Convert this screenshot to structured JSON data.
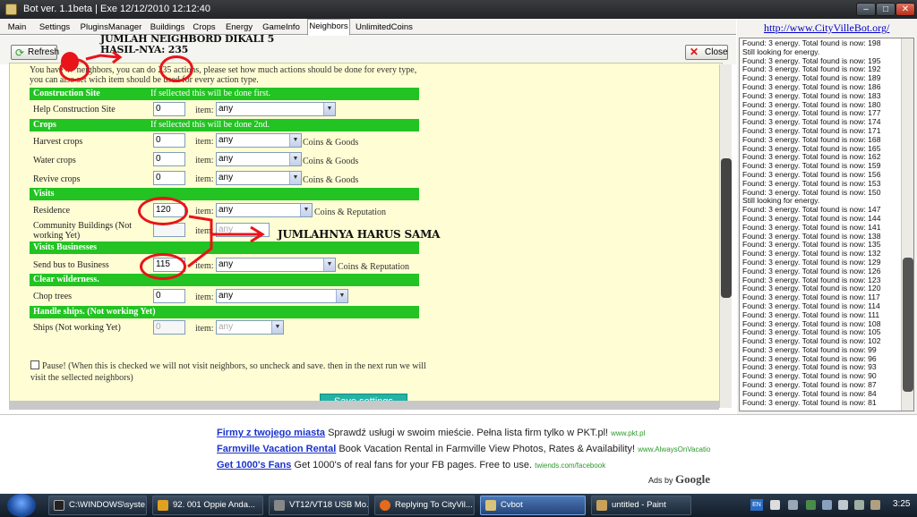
{
  "window": {
    "title": "Bot ver. 1.1beta | Exe 12/12/2010 12:12:40"
  },
  "tabs": [
    "Main",
    "Settings",
    "PluginsManager",
    "Buildings",
    "Crops",
    "Energy",
    "GameInfo",
    "Neighbors",
    "UnlimitedCoins"
  ],
  "active_tab": "Neighbors",
  "toolbar": {
    "refresh": "Refresh",
    "close": "Close"
  },
  "info_text": "You have 47 neighbors, you can do 235 actions, please set how much actions should be done for every type, you can also set wich item should be used for every action type.",
  "form": {
    "item_label": "item:",
    "construction": {
      "title": "Construction Site",
      "note": "If sellected this will be done first.",
      "row_label": "Help Construction Site",
      "value": "0",
      "item": "any"
    },
    "crops": {
      "title": "Crops",
      "note": "If sellected this will be done 2nd.",
      "harvest": {
        "label": "Harvest crops",
        "value": "0",
        "item": "any",
        "suffix": "Coins & Goods"
      },
      "water": {
        "label": "Water crops",
        "value": "0",
        "item": "any",
        "suffix": "Coins & Goods"
      },
      "revive": {
        "label": "Revive crops",
        "value": "0",
        "item": "any",
        "suffix": "Coins & Goods"
      }
    },
    "visits": {
      "title": "Visits",
      "residence": {
        "label": "Residence",
        "value": "120",
        "item": "any",
        "suffix": "Coins & Reputation"
      },
      "community": {
        "label": "Community Buildings (Not working Yet)",
        "value": "",
        "item": "any"
      }
    },
    "businesses": {
      "title": "Visits Businesses",
      "bus": {
        "label": "Send bus to Business",
        "value": "115",
        "item": "any",
        "suffix": "Coins & Reputation"
      }
    },
    "wilderness": {
      "title": "Clear wilderness.",
      "chop": {
        "label": "Chop trees",
        "value": "0",
        "item": "any"
      }
    },
    "ships": {
      "title": "Handle ships. (Not working Yet)",
      "ships": {
        "label": "Ships (Not working Yet)",
        "value": "0",
        "item": "any"
      }
    },
    "pause_text": "Pause! (When this is checked we will not visit neighbors, so uncheck and save. then in the next run we will visit the sellected neighbors)",
    "save_label": "Save settings"
  },
  "annotations": {
    "top_note": "JUMLAH NEIGHBORD DIKALI 5 HASIL-NYA: 235",
    "middle_note": "JUMLAHNYA HARUS SAMA"
  },
  "right_panel": {
    "link": "http://www.CityVilleBot.org/",
    "log": [
      "Found: 3 energy. Total found is now: 198",
      "Still looking for energy.",
      "Found: 3 energy. Total found is now: 195",
      "Found: 3 energy. Total found is now: 192",
      "Found: 3 energy. Total found is now: 189",
      "Found: 3 energy. Total found is now: 186",
      "Found: 3 energy. Total found is now: 183",
      "Found: 3 energy. Total found is now: 180",
      "Found: 3 energy. Total found is now: 177",
      "Found: 3 energy. Total found is now: 174",
      "Found: 3 energy. Total found is now: 171",
      "Found: 3 energy. Total found is now: 168",
      "Found: 3 energy. Total found is now: 165",
      "Found: 3 energy. Total found is now: 162",
      "Found: 3 energy. Total found is now: 159",
      "Found: 3 energy. Total found is now: 156",
      "Found: 3 energy. Total found is now: 153",
      "Found: 3 energy. Total found is now: 150",
      "Still looking for energy.",
      "Found: 3 energy. Total found is now: 147",
      "Found: 3 energy. Total found is now: 144",
      "Found: 3 energy. Total found is now: 141",
      "Found: 3 energy. Total found is now: 138",
      "Found: 3 energy. Total found is now: 135",
      "Found: 3 energy. Total found is now: 132",
      "Found: 3 energy. Total found is now: 129",
      "Found: 3 energy. Total found is now: 126",
      "Found: 3 energy. Total found is now: 123",
      "Found: 3 energy. Total found is now: 120",
      "Found: 3 energy. Total found is now: 117",
      "Found: 3 energy. Total found is now: 114",
      "Found: 3 energy. Total found is now: 111",
      "Found: 3 energy. Total found is now: 108",
      "Found: 3 energy. Total found is now: 105",
      "Found: 3 energy. Total found is now: 102",
      "Found: 3 energy. Total found is now: 99",
      "Found: 3 energy. Total found is now: 96",
      "Found: 3 energy. Total found is now: 93",
      "Found: 3 energy. Total found is now: 90",
      "Found: 3 energy. Total found is now: 87",
      "Found: 3 energy. Total found is now: 84",
      "Found: 3 energy. Total found is now: 81"
    ]
  },
  "ads": [
    {
      "title": "Firmy z twojego miasta",
      "text": "Sprawdź usługi w swoim mieście. Pełna lista firm tylko w PKT.pl!",
      "url": "www.pkt.pl"
    },
    {
      "title": "Farmville Vacation Rental",
      "text": "Book Vacation Rental in Farmville View Photos, Rates & Availability!",
      "url": "www.AlwaysOnVacatio"
    },
    {
      "title": "Get 1000's Fans",
      "text": "Get 1000's of real fans for your FB pages. Free to use.",
      "url": "twiends.com/facebook"
    }
  ],
  "ads_by": {
    "prefix": "Ads by",
    "brand": "Google"
  },
  "taskbar": {
    "items": [
      "C:\\WINDOWS\\syste...",
      "92. 001 Oppie Anda...",
      "VT12/VT18 USB Mo...",
      "Replying To CityVil...",
      "Cvbot",
      "untitled - Paint"
    ],
    "active": "Cvbot",
    "lang": "EN",
    "clock": "3:25"
  }
}
